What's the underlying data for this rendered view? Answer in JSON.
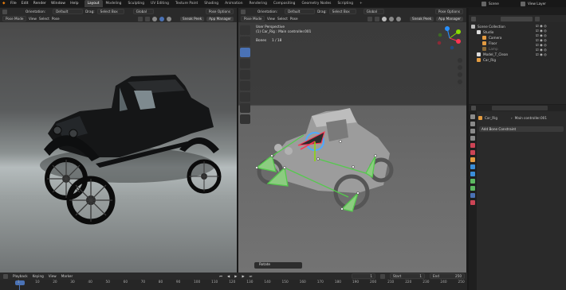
{
  "menu": [
    "File",
    "Edit",
    "Render",
    "Window",
    "Help"
  ],
  "workspaces": [
    "Layout",
    "Modeling",
    "Sculpting",
    "UV Editing",
    "Texture Paint",
    "Shading",
    "Animation",
    "Rendering",
    "Compositing",
    "Geometry Nodes",
    "Scripting",
    "+"
  ],
  "active_workspace": "Layout",
  "scene": {
    "label": "Scene",
    "view_layer": "View Layer"
  },
  "left_view": {
    "orientation_label": "Orientation:",
    "orientation": "Default",
    "drag_label": "Drag:",
    "drag": "Select Box",
    "transform": "Global",
    "pose_options": "Pose Options",
    "mode": "Pose Mode",
    "view": "View",
    "select": "Select",
    "pose": "Pose",
    "sneak_peek": "Sneak Peek",
    "app_manager": "App Manager"
  },
  "right_view": {
    "orientation_label": "Orientation:",
    "orientation": "Default",
    "drag_label": "Drag:",
    "drag": "Select Box",
    "transform": "Global",
    "pose_options": "Pose Options",
    "mode": "Pose Mode",
    "view": "View",
    "select": "Select",
    "pose": "Pose",
    "sneak_peek": "Sneak Peek",
    "app_manager": "App Manager",
    "overlay_title": "User Perspective",
    "overlay_object": "(1) Car_Rig : Main controller.001",
    "bones_label": "Bones",
    "bones_value": "1 / 18",
    "operator": "Rotate",
    "gizmo_axes": [
      "X",
      "Y",
      "Z"
    ]
  },
  "outliner": {
    "items": [
      {
        "name": "Scene Collection",
        "indent": 0
      },
      {
        "name": "Studio",
        "indent": 1
      },
      {
        "name": "Camera",
        "indent": 2
      },
      {
        "name": "Floor",
        "indent": 2
      },
      {
        "name": "Lamp",
        "indent": 2
      },
      {
        "name": "Model_T_Clean",
        "indent": 1
      },
      {
        "name": "Car_Rig",
        "indent": 1
      }
    ]
  },
  "properties": {
    "object": "Car_Rig",
    "bone": "Main controller.001",
    "add_constraint": "Add Bone Constraint"
  },
  "timeline": {
    "playback": "Playback",
    "keying": "Keying",
    "view": "View",
    "marker": "Marker",
    "current": "1",
    "start_label": "Start",
    "start": "1",
    "end_label": "End",
    "end": "250",
    "ticks": [
      "1",
      "10",
      "20",
      "30",
      "40",
      "50",
      "60",
      "70",
      "80",
      "90",
      "100",
      "110",
      "120",
      "130",
      "140",
      "150",
      "160",
      "170",
      "180",
      "190",
      "200",
      "210",
      "220",
      "230",
      "240",
      "250"
    ]
  },
  "colors": {
    "accent": "#4a72b5",
    "bone_green": "#55c94d",
    "active_bone": "#4fa8ff",
    "x_axis": "#ff3352",
    "y_axis": "#8bdc00",
    "z_axis": "#2890ff"
  }
}
